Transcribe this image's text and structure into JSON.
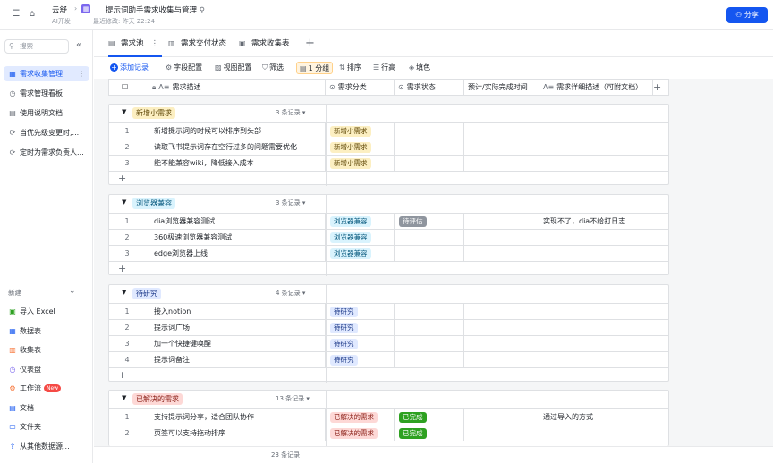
{
  "topbar": {
    "workspace": "云舒",
    "workspace_sub": "AI开发",
    "doc_title": "提示词助手需求收集与管理",
    "doc_sub": "最近修改: 昨天 22:24",
    "share_label": "分享",
    "accent": "#1456f0"
  },
  "sidebar": {
    "search_placeholder": "搜索",
    "items": [
      {
        "label": "需求收集管理",
        "icon": "table-icon",
        "active": true
      },
      {
        "label": "需求管理看板",
        "icon": "dashboard-icon"
      },
      {
        "label": "使用说明文档",
        "icon": "doc-icon"
      },
      {
        "label": "当优先级变更时,...",
        "icon": "automation-icon"
      },
      {
        "label": "定时为需求负责人...",
        "icon": "automation-icon"
      }
    ],
    "new_label": "新建",
    "new_items": [
      {
        "label": "导入 Excel",
        "icon": "excel-icon"
      },
      {
        "label": "数据表",
        "icon": "table-icon"
      },
      {
        "label": "收集表",
        "icon": "form-icon"
      },
      {
        "label": "仪表盘",
        "icon": "dashboard-icon"
      },
      {
        "label": "工作流",
        "icon": "workflow-icon",
        "badge": "New"
      },
      {
        "label": "文档",
        "icon": "doc-icon"
      },
      {
        "label": "文件夹",
        "icon": "folder-icon"
      },
      {
        "label": "从其他数据源...",
        "icon": "import-icon"
      }
    ]
  },
  "tabs": [
    {
      "label": "需求池",
      "active": true
    },
    {
      "label": "需求交付状态"
    },
    {
      "label": "需求收集表"
    }
  ],
  "toolbar": {
    "add": "添加记录",
    "fields": "字段配置",
    "view": "视图配置",
    "filter": "筛选",
    "group": "1 分组",
    "sort": "排序",
    "rowheight": "行高",
    "fill": "填色"
  },
  "columns": [
    "需求描述",
    "需求分类",
    "需求状态",
    "预计/实际完成时间",
    "需求详细描述（可附文档）"
  ],
  "groups": [
    {
      "name": "新增小需求",
      "count": "3 条记录",
      "color": "yellow",
      "rows": [
        {
          "n": "1",
          "desc": "新增提示词的时候可以排序到头部",
          "cat": "新增小需求",
          "status": "",
          "time": "",
          "detail": ""
        },
        {
          "n": "2",
          "desc": "读取飞书提示词存在空行过多的问题需要优化",
          "cat": "新增小需求",
          "status": "",
          "time": "",
          "detail": ""
        },
        {
          "n": "3",
          "desc": "能不能兼容wiki，降低接入成本",
          "cat": "新增小需求",
          "status": "",
          "time": "",
          "detail": ""
        }
      ]
    },
    {
      "name": "浏览器兼容",
      "count": "3 条记录",
      "color": "blue",
      "rows": [
        {
          "n": "1",
          "desc": "dia浏览器兼容测试",
          "cat": "浏览器兼容",
          "status": "待评估",
          "status_color": "gray",
          "time": "",
          "detail": "实现不了，dia不给打日志"
        },
        {
          "n": "2",
          "desc": "360极速浏览器兼容测试",
          "cat": "浏览器兼容",
          "status": "",
          "time": "",
          "detail": ""
        },
        {
          "n": "3",
          "desc": "edge浏览器上线",
          "cat": "浏览器兼容",
          "status": "",
          "time": "",
          "detail": ""
        }
      ]
    },
    {
      "name": "待研究",
      "count": "4 条记录",
      "color": "indigo",
      "rows": [
        {
          "n": "1",
          "desc": "接入notion",
          "cat": "待研究",
          "status": "",
          "time": "",
          "detail": ""
        },
        {
          "n": "2",
          "desc": "提示词广场",
          "cat": "待研究",
          "status": "",
          "time": "",
          "detail": ""
        },
        {
          "n": "3",
          "desc": "加一个快捷键唤醒",
          "cat": "待研究",
          "status": "",
          "time": "",
          "detail": ""
        },
        {
          "n": "4",
          "desc": "提示词备注",
          "cat": "待研究",
          "status": "",
          "time": "",
          "detail": ""
        }
      ]
    },
    {
      "name": "已解决的需求",
      "count": "13 条记录",
      "color": "red",
      "rows": [
        {
          "n": "1",
          "desc": "支持提示词分享，适合团队协作",
          "cat": "已解决的需求",
          "status": "已完成",
          "status_color": "green",
          "time": "",
          "detail": "通过导入的方式"
        },
        {
          "n": "2",
          "desc": "页签可以支持拖动排序",
          "cat": "已解决的需求",
          "status": "已完成",
          "status_color": "green",
          "time": "",
          "detail": ""
        }
      ]
    }
  ],
  "footer_count": "23 条记录"
}
